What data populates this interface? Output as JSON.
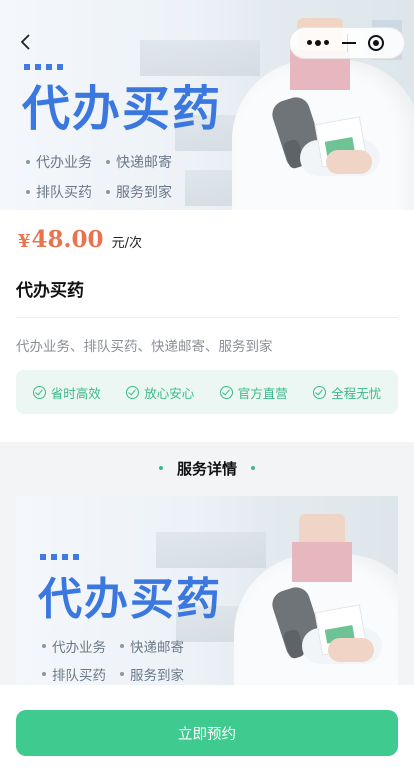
{
  "hero": {
    "title": "代办买药",
    "features_row1": [
      "代办业务",
      "快递邮寄"
    ],
    "features_row2": [
      "排队买药",
      "服务到家"
    ],
    "accent_color": "#3a78e0"
  },
  "nav": {
    "back_icon": "chevron-left-icon",
    "more_icon": "more-dots-icon",
    "minimize_icon": "minus-icon",
    "close_icon": "target-circle-icon"
  },
  "product": {
    "currency": "¥",
    "price": "48.00",
    "unit": "元/次",
    "name": "代办买药",
    "description": "代办业务、排队买药、快递邮寄、服务到家",
    "tags": [
      "省时高效",
      "放心安心",
      "官方直营",
      "全程无忧"
    ],
    "price_color": "#e9734d",
    "tag_color": "#3db88a"
  },
  "details": {
    "heading": "服务详情",
    "banner_title": "代办买药",
    "features_row1": [
      "代办业务",
      "快递邮寄"
    ],
    "features_row2": [
      "排队买药",
      "服务到家"
    ]
  },
  "action": {
    "book_label": "立即预约",
    "button_color": "#3fcb8f"
  }
}
